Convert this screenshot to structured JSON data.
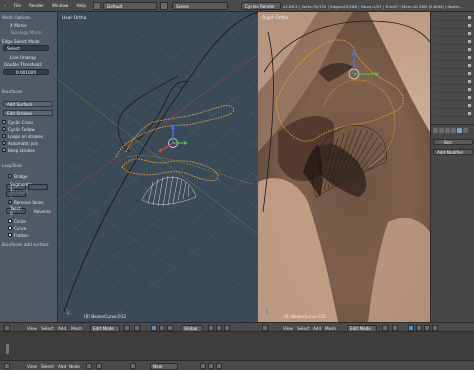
{
  "top_bar": {
    "menus": [
      "File",
      "Render",
      "Window",
      "Help"
    ],
    "layout": "Default",
    "scene": "Scene",
    "engine": "Cycles Render",
    "stats": "v2.69.2 | Verts:79/132 | Edges:85/188 | Faces:1/57 | Tris:67 | Mem:10.38M (0.80M) | 8ezier..."
  },
  "tool_shelf": {
    "title": "Mesh Options",
    "x_mirror": "X Mirror",
    "topology_mirror": "Topology Mirror",
    "edge_select_mode": "Edge Select Mode",
    "edge_select_value": "Select",
    "live_unwrap": "Live Unwrap",
    "double_threshold": "Double Threshold:",
    "double_threshold_value": "0.001000",
    "bsurfaces_header": "Bsurfaces",
    "add_surface": "Add Surface",
    "edit_strokes": "Edit Strokes",
    "cyclic_cross": "Cyclic Cross",
    "cyclic_follow": "Cyclic Follow",
    "loops_on_strokes": "Loops on strokes",
    "automatic_join": "Automatic join",
    "keep_strokes": "Keep strokes",
    "looptools_header": "LoopTools",
    "bridge": "Bridge",
    "segments": "Segments: 1",
    "strength": "Strength: 1",
    "remove_faces": "Remove faces",
    "twist": "Twist: 0",
    "reverse": "Reverse",
    "circle": "Circle",
    "curve": "Curve",
    "flatten": "Flatten",
    "bsurfaces_add_surface": "Bsurfaces add surface"
  },
  "viewport_left": {
    "label": "User Ortho",
    "footer": "(0) BezierCurve.012"
  },
  "viewport_right": {
    "label": "Right Ortho",
    "footer": "(0) BezierCurve.012"
  },
  "properties": {
    "add_modifier": "Add Modifier",
    "object_name": "Bez"
  },
  "viewport_header": {
    "view": "View",
    "select": "Select",
    "add": "Add",
    "mesh": "Mesh",
    "mode": "Edit Mode",
    "pivot": "Global",
    "view_right": "View",
    "select_right": "Select",
    "add_right": "Add",
    "mesh_right": "Mesh",
    "mode_right": "Edit Mode"
  },
  "timeline_header": {
    "view": "View",
    "select": "Select",
    "add": "Add",
    "node": "Node",
    "new": "New"
  },
  "colors": {
    "curve_orange": "#e8a037",
    "mesh_gray": "#d8d8d8",
    "axis_x": "#e04545",
    "axis_y": "#45c045",
    "axis_z": "#4575e0",
    "select_blue": "#5b8fd0"
  }
}
